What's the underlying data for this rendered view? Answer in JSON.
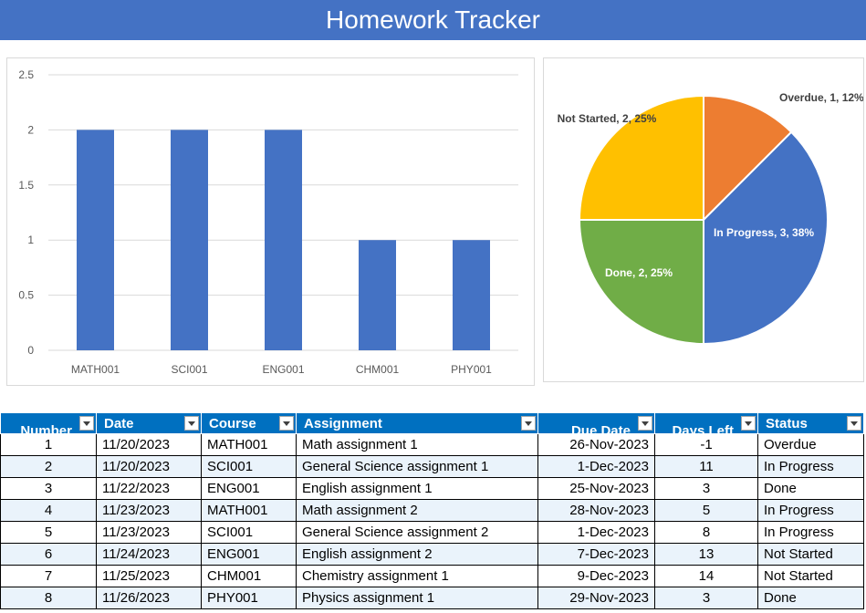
{
  "title": "Homework Tracker",
  "colors": {
    "header_bg": "#4472c4",
    "table_header_bg": "#0070c0",
    "bar": "#4472c4",
    "grid": "#d9d9d9",
    "alt_row": "#eaf3fb"
  },
  "chart_data": [
    {
      "type": "bar",
      "categories": [
        "MATH001",
        "SCI001",
        "ENG001",
        "CHM001",
        "PHY001"
      ],
      "values": [
        2,
        2,
        2,
        1,
        1
      ],
      "ylim": [
        0,
        2.5
      ],
      "yticks": [
        "0",
        "0.5",
        "1",
        "1.5",
        "2",
        "2.5"
      ],
      "grid": true
    },
    {
      "type": "pie",
      "slices": [
        {
          "name": "Overdue",
          "value": 1,
          "percent": "12%",
          "label": "Overdue, 1, 12%",
          "color": "#ed7d31"
        },
        {
          "name": "In Progress",
          "value": 3,
          "percent": "38%",
          "label": "In Progress, 3, 38%",
          "color": "#4472c4"
        },
        {
          "name": "Done",
          "value": 2,
          "percent": "25%",
          "label": "Done, 2, 25%",
          "color": "#70ad47"
        },
        {
          "name": "Not Started",
          "value": 2,
          "percent": "25%",
          "label": "Not Started, 2, 25%",
          "color": "#ffc000"
        }
      ]
    }
  ],
  "table": {
    "headers": [
      "Number",
      "Date",
      "Course",
      "Assignment",
      "Due Date",
      "Days Left",
      "Status"
    ],
    "rows": [
      [
        "1",
        "11/20/2023",
        "MATH001",
        "Math assignment 1",
        "26-Nov-2023",
        "-1",
        "Overdue"
      ],
      [
        "2",
        "11/20/2023",
        "SCI001",
        "General Science assignment 1",
        "1-Dec-2023",
        "11",
        "In Progress"
      ],
      [
        "3",
        "11/22/2023",
        "ENG001",
        "English assignment 1",
        "25-Nov-2023",
        "3",
        "Done"
      ],
      [
        "4",
        "11/23/2023",
        "MATH001",
        "Math assignment 2",
        "28-Nov-2023",
        "5",
        "In Progress"
      ],
      [
        "5",
        "11/23/2023",
        "SCI001",
        "General Science assignment 2",
        "1-Dec-2023",
        "8",
        "In Progress"
      ],
      [
        "6",
        "11/24/2023",
        "ENG001",
        "English assignment 2",
        "7-Dec-2023",
        "13",
        "Not Started"
      ],
      [
        "7",
        "11/25/2023",
        "CHM001",
        "Chemistry assignment 1",
        "9-Dec-2023",
        "14",
        "Not Started"
      ],
      [
        "8",
        "11/26/2023",
        "PHY001",
        "Physics assignment 1",
        "29-Nov-2023",
        "3",
        "Done"
      ]
    ]
  }
}
